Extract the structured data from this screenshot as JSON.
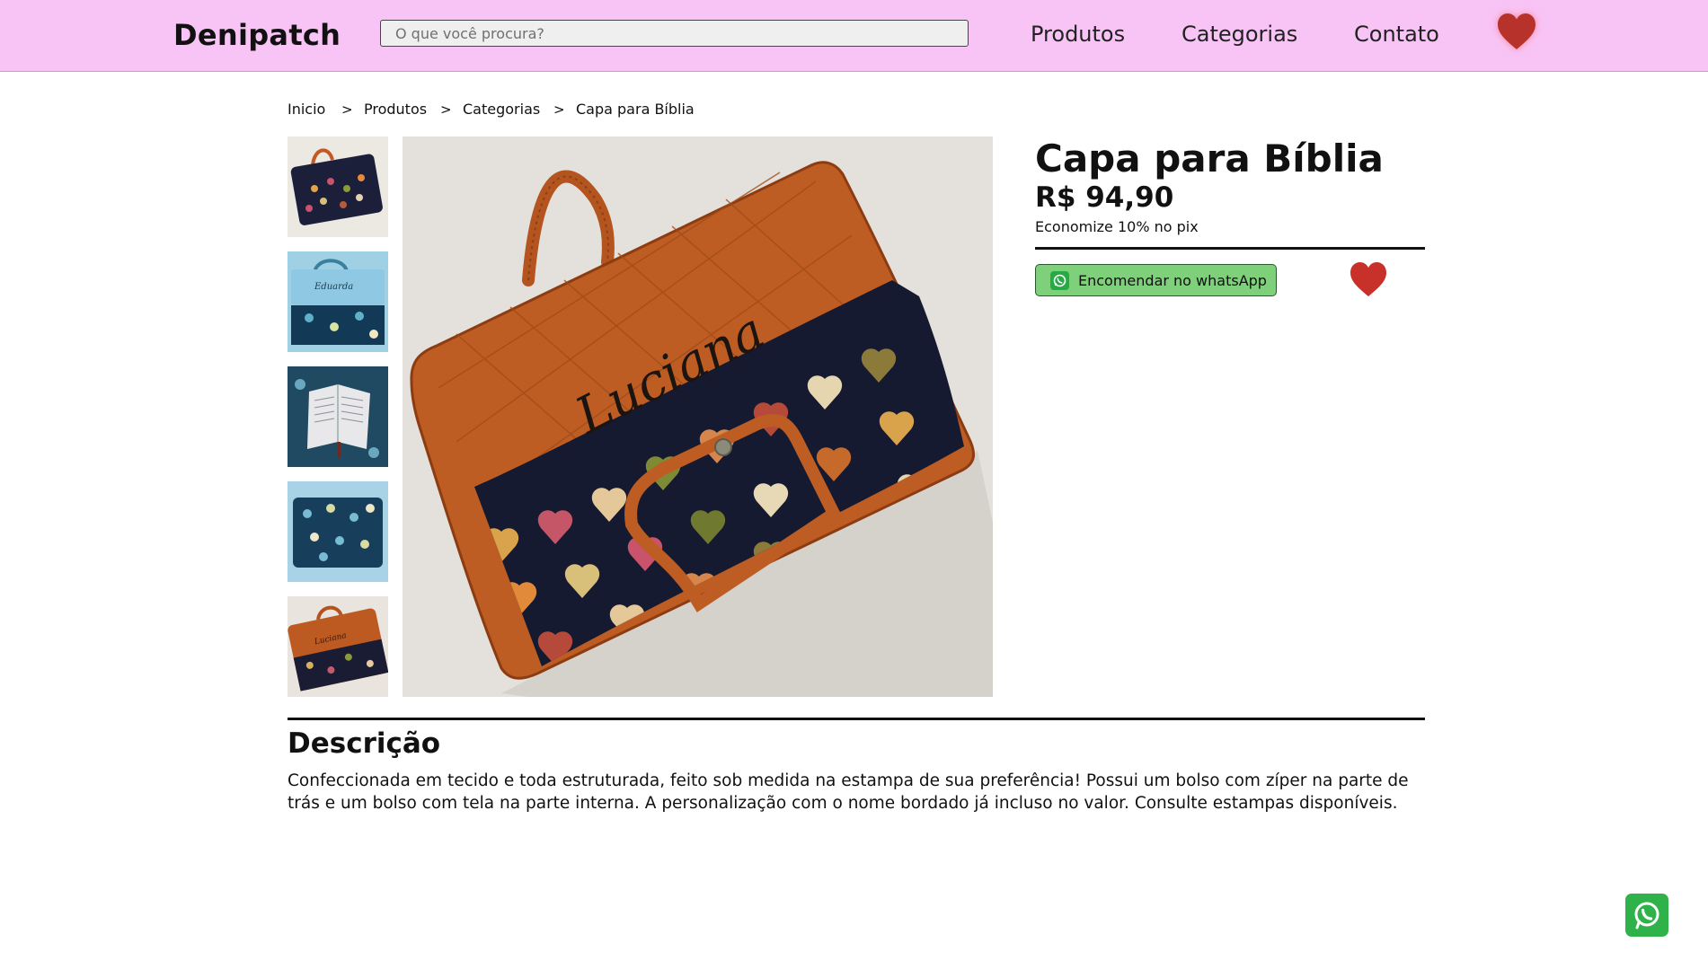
{
  "header": {
    "logo": "Denipatch",
    "search_placeholder": "O que você procura?",
    "nav": [
      "Produtos",
      "Categorias",
      "Contato"
    ],
    "favorites_icon": "heart-icon"
  },
  "breadcrumb": {
    "items": [
      "Inicio",
      "Produtos",
      "Categorias",
      "Capa para Bíblia"
    ],
    "separator": ">"
  },
  "gallery": {
    "thumbnails": 5,
    "selected": 4
  },
  "product": {
    "title": "Capa para Bíblia",
    "price": "R$ 94,90",
    "pix_note": "Economize 10% no pix",
    "order_button": "Encomendar no whatsApp",
    "embroidered_name": "Luciana"
  },
  "description": {
    "title": "Descrição",
    "text": "Confeccionada em tecido e toda estruturada, feito sob medida na estampa de sua preferência! Possui um bolso com zíper na parte de trás e um bolso com tela na parte interna. A personalização com o nome bordado já incluso no valor. Consulte estampas disponíveis."
  },
  "colors": {
    "header_bg": "#f8c4f5",
    "heart": "#c8312a",
    "whatsapp_green": "#2fb24a",
    "button_green": "#7ed07a"
  },
  "floating": {
    "icon": "whatsapp-icon"
  }
}
